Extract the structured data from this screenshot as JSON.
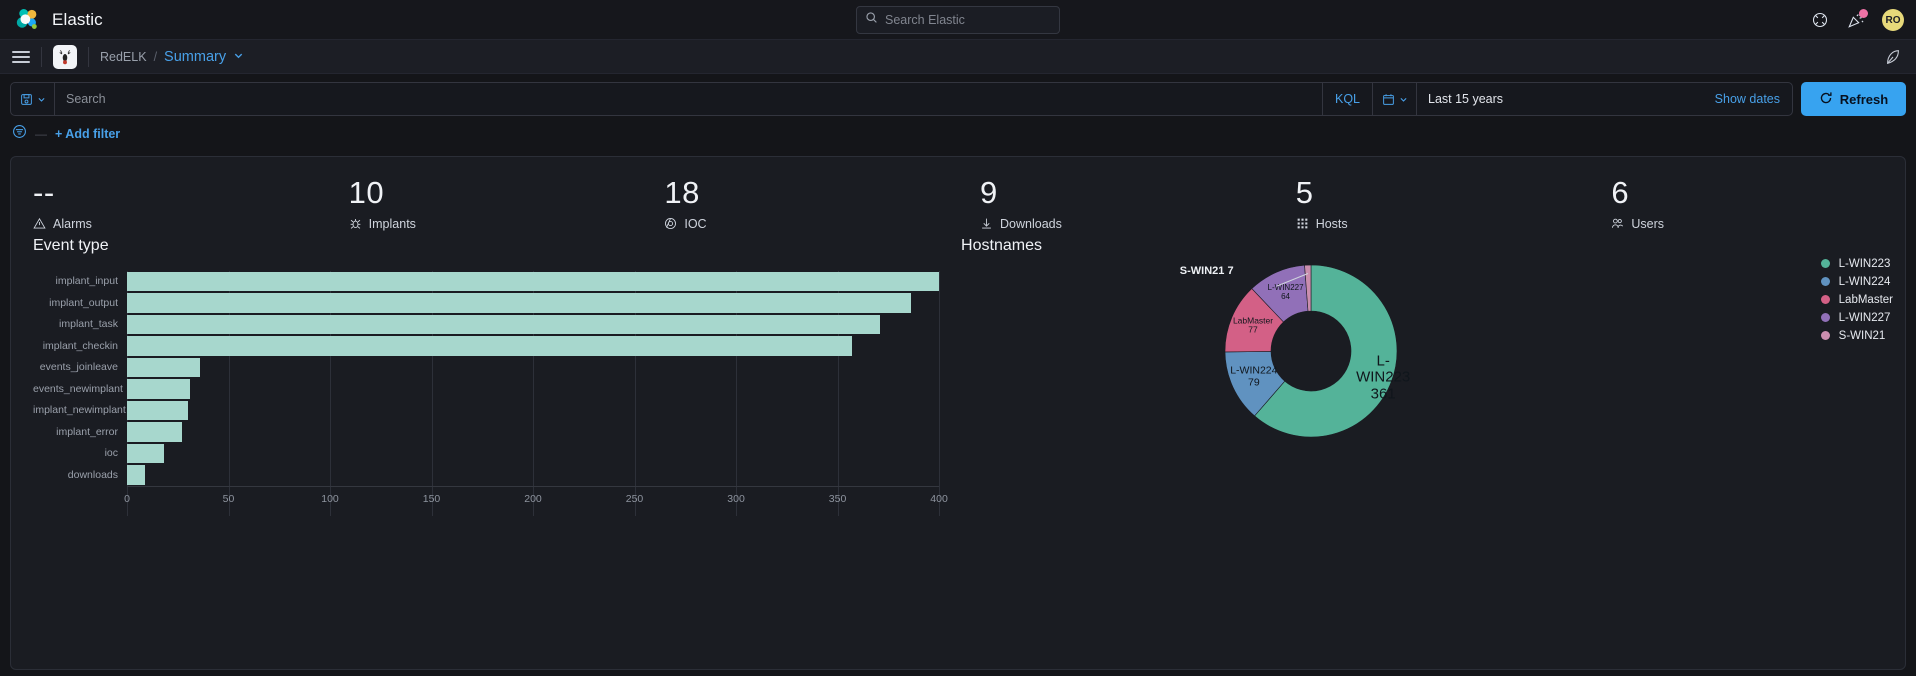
{
  "global_header": {
    "brand": "Elastic",
    "logo_icon": "elastic-logo",
    "search": {
      "placeholder": "Search Elastic",
      "icon": "search-icon"
    },
    "help_icon": "help-circle-icon",
    "announcements_icon": "party-popper-icon",
    "announcements_badge": "",
    "avatar_initials": "RO"
  },
  "breadcrumb_bar": {
    "menu_icon": "hamburger-menu-icon",
    "app_icon": "redelk-deer-logo",
    "crumb_root": "RedELK",
    "separator": "/",
    "crumb_active": "Summary",
    "caret_icon": "chevron-down-icon",
    "right_icon": "kibana-feather-icon"
  },
  "query_bar": {
    "saved_query_icon": "save-disk-icon",
    "saved_query_caret": "chevron-down-icon",
    "search_placeholder": "Search",
    "language_label": "KQL",
    "calendar_icon": "calendar-icon",
    "calendar_caret": "chevron-down-icon",
    "date_range": "Last 15 years",
    "show_dates_label": "Show dates",
    "refresh_label": "Refresh",
    "refresh_icon": "refresh-icon",
    "refresh_color": "#37a3f0"
  },
  "filter_bar": {
    "filter_icon": "filter-settings-icon",
    "dash": "—",
    "add_filter_label": "+ Add filter"
  },
  "metrics": [
    {
      "value": "--",
      "label": "Alarms",
      "icon": "warning-triangle-icon"
    },
    {
      "value": "10",
      "label": "Implants",
      "icon": "bug-icon"
    },
    {
      "value": "18",
      "label": "IOC",
      "icon": "target-icon"
    },
    {
      "value": "9",
      "label": "Downloads",
      "icon": "download-icon"
    },
    {
      "value": "5",
      "label": "Hosts",
      "icon": "grid-hosts-icon"
    },
    {
      "value": "6",
      "label": "Users",
      "icon": "users-icon"
    }
  ],
  "chart_data": [
    {
      "type": "bar",
      "title": "Event type",
      "orientation": "horizontal",
      "xlabel": "",
      "ylabel": "",
      "xlim": [
        0,
        400
      ],
      "xticks": [
        0,
        50,
        100,
        150,
        200,
        250,
        300,
        350,
        400
      ],
      "grid": true,
      "bar_color": "#a7d7cd",
      "categories": [
        "implant_input",
        "implant_output",
        "implant_task",
        "implant_checkin",
        "events_joinleave",
        "events_newimplant",
        "implant_newimplant",
        "implant_error",
        "ioc",
        "downloads"
      ],
      "values": [
        404,
        386,
        371,
        357,
        36,
        31,
        30,
        27,
        18,
        9
      ]
    },
    {
      "type": "pie",
      "subtype": "donut",
      "title": "Hostnames",
      "legend_position": "right",
      "labels": [
        "L-WIN223",
        "L-WIN224",
        "LabMaster",
        "L-WIN227",
        "S-WIN21"
      ],
      "values": [
        361,
        79,
        77,
        64,
        7
      ],
      "colors": [
        "#54b399",
        "#6092c0",
        "#d36086",
        "#9170b8",
        "#ca8eae"
      ]
    }
  ]
}
